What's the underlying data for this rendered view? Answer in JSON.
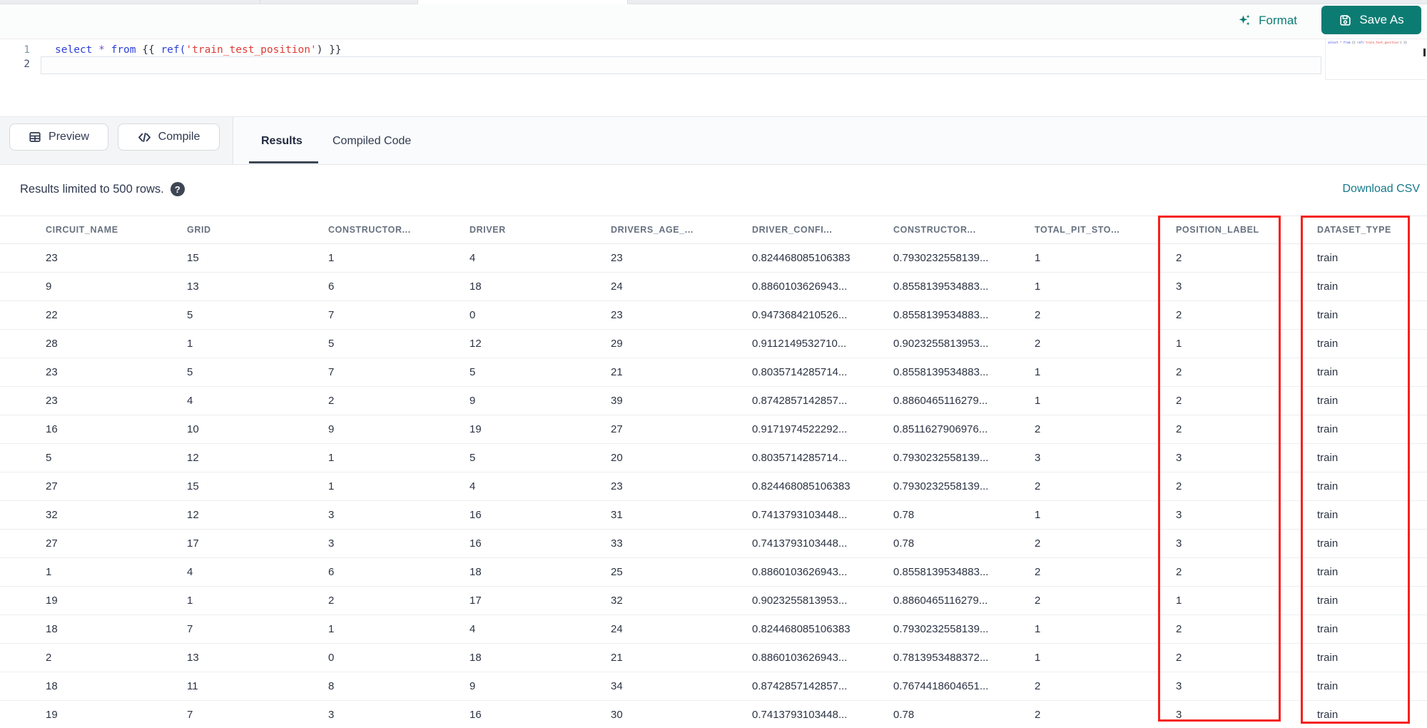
{
  "topbar": {
    "format_label": "Format",
    "save_as_label": "Save As"
  },
  "editor": {
    "lines": [
      {
        "number": "1",
        "tokens": [
          {
            "t": "select",
            "c": "kw"
          },
          {
            "t": " ",
            "c": "pl"
          },
          {
            "t": "*",
            "c": "op"
          },
          {
            "t": " ",
            "c": "pl"
          },
          {
            "t": "from",
            "c": "kw"
          },
          {
            "t": " ",
            "c": "pl"
          },
          {
            "t": "{{",
            "c": "br"
          },
          {
            "t": " ",
            "c": "pl"
          },
          {
            "t": "ref",
            "c": "fn"
          },
          {
            "t": "(",
            "c": "fn"
          },
          {
            "t": "'train_test_position'",
            "c": "str"
          },
          {
            "t": ")",
            "c": "br"
          },
          {
            "t": " ",
            "c": "pl"
          },
          {
            "t": "}}",
            "c": "br"
          }
        ]
      },
      {
        "number": "2",
        "tokens": []
      }
    ]
  },
  "query_toolbar": {
    "preview_label": "Preview",
    "compile_label": "Compile"
  },
  "result_tabs": {
    "results_label": "Results",
    "compiled_label": "Compiled Code",
    "active": "Results"
  },
  "results_bar": {
    "limit_notice": "Results limited to 500 rows.",
    "help_icon": "?",
    "download_label": "Download CSV"
  },
  "table": {
    "columns": [
      "CIRCUIT_NAME",
      "GRID",
      "CONSTRUCTOR...",
      "DRIVER",
      "DRIVERS_AGE_...",
      "DRIVER_CONFI...",
      "CONSTRUCTOR...",
      "TOTAL_PIT_STO...",
      "POSITION_LABEL",
      "DATASET_TYPE"
    ],
    "rows": [
      [
        "23",
        "15",
        "1",
        "4",
        "23",
        "0.824468085106383",
        "0.7930232558139...",
        "1",
        "2",
        "train"
      ],
      [
        "9",
        "13",
        "6",
        "18",
        "24",
        "0.8860103626943...",
        "0.8558139534883...",
        "1",
        "3",
        "train"
      ],
      [
        "22",
        "5",
        "7",
        "0",
        "23",
        "0.9473684210526...",
        "0.8558139534883...",
        "2",
        "2",
        "train"
      ],
      [
        "28",
        "1",
        "5",
        "12",
        "29",
        "0.9112149532710...",
        "0.9023255813953...",
        "2",
        "1",
        "train"
      ],
      [
        "23",
        "5",
        "7",
        "5",
        "21",
        "0.8035714285714...",
        "0.8558139534883...",
        "1",
        "2",
        "train"
      ],
      [
        "23",
        "4",
        "2",
        "9",
        "39",
        "0.8742857142857...",
        "0.8860465116279...",
        "1",
        "2",
        "train"
      ],
      [
        "16",
        "10",
        "9",
        "19",
        "27",
        "0.9171974522292...",
        "0.8511627906976...",
        "2",
        "2",
        "train"
      ],
      [
        "5",
        "12",
        "1",
        "5",
        "20",
        "0.8035714285714...",
        "0.7930232558139...",
        "3",
        "3",
        "train"
      ],
      [
        "27",
        "15",
        "1",
        "4",
        "23",
        "0.824468085106383",
        "0.7930232558139...",
        "2",
        "2",
        "train"
      ],
      [
        "32",
        "12",
        "3",
        "16",
        "31",
        "0.7413793103448...",
        "0.78",
        "1",
        "3",
        "train"
      ],
      [
        "27",
        "17",
        "3",
        "16",
        "33",
        "0.7413793103448...",
        "0.78",
        "2",
        "3",
        "train"
      ],
      [
        "1",
        "4",
        "6",
        "18",
        "25",
        "0.8860103626943...",
        "0.8558139534883...",
        "2",
        "2",
        "train"
      ],
      [
        "19",
        "1",
        "2",
        "17",
        "32",
        "0.9023255813953...",
        "0.8860465116279...",
        "2",
        "1",
        "train"
      ],
      [
        "18",
        "7",
        "1",
        "4",
        "24",
        "0.824468085106383",
        "0.7930232558139...",
        "1",
        "2",
        "train"
      ],
      [
        "2",
        "13",
        "0",
        "18",
        "21",
        "0.8860103626943...",
        "0.7813953488372...",
        "1",
        "2",
        "train"
      ],
      [
        "18",
        "11",
        "8",
        "9",
        "34",
        "0.8742857142857...",
        "0.7674418604651...",
        "2",
        "3",
        "train"
      ],
      [
        "19",
        "7",
        "3",
        "16",
        "30",
        "0.7413793103448...",
        "0.78",
        "2",
        "3",
        "train"
      ]
    ],
    "highlighted_columns": [
      "POSITION_LABEL",
      "DATASET_TYPE"
    ]
  },
  "colors": {
    "accent_teal": "#0c7c73",
    "link_teal": "#15798a",
    "highlight_red": "#f5211d"
  }
}
